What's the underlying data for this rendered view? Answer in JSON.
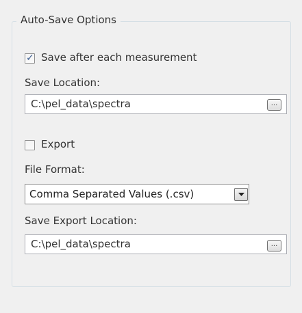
{
  "group": {
    "title": "Auto-Save Options"
  },
  "save_after": {
    "label": "Save after each measurement",
    "checked": true
  },
  "save_location": {
    "label": "Save Location:",
    "value": "C:\\pel_data\\spectra",
    "browse_label": "..."
  },
  "export": {
    "label": "Export",
    "checked": false
  },
  "file_format": {
    "label": "File Format:",
    "selected": "Comma Separated Values (.csv)"
  },
  "export_location": {
    "label": "Save Export Location:",
    "value": "C:\\pel_data\\spectra",
    "browse_label": "..."
  }
}
